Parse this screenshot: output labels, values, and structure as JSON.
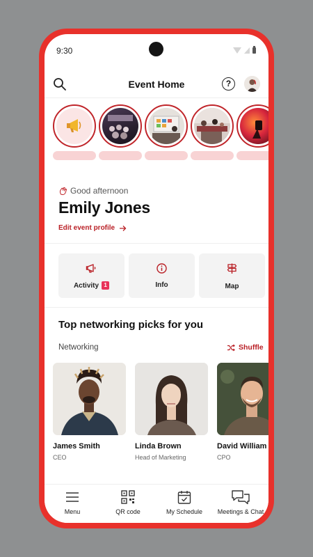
{
  "status_bar": {
    "time": "9:30"
  },
  "header": {
    "title": "Event Home",
    "help_label": "?"
  },
  "greeting": {
    "text": "Good afternoon",
    "name": "Emily Jones",
    "edit_link": "Edit event profile"
  },
  "quick_actions": [
    {
      "label": "Activity",
      "badge": "1",
      "icon": "megaphone-icon"
    },
    {
      "label": "Info",
      "icon": "info-icon"
    },
    {
      "label": "Map",
      "icon": "signpost-icon"
    }
  ],
  "networking": {
    "title": "Top networking picks for you",
    "subtitle": "Networking",
    "shuffle_label": "Shuffle",
    "people": [
      {
        "name": "James Smith",
        "role": "CEO"
      },
      {
        "name": "Linda Brown",
        "role": "Head of Marketing"
      },
      {
        "name": "David William",
        "role": "CPO"
      }
    ]
  },
  "bottom_nav": [
    {
      "label": "Menu",
      "icon": "hamburger-menu-icon"
    },
    {
      "label": "QR code",
      "icon": "qr-code-icon"
    },
    {
      "label": "My Schedule",
      "icon": "calendar-check-icon"
    },
    {
      "label": "Meetings & Chat",
      "icon": "chat-bubbles-icon"
    }
  ],
  "colors": {
    "accent": "#b91f25",
    "frame": "#e8312b",
    "badge": "#e8335a",
    "story_label": "#f8d3d4"
  }
}
